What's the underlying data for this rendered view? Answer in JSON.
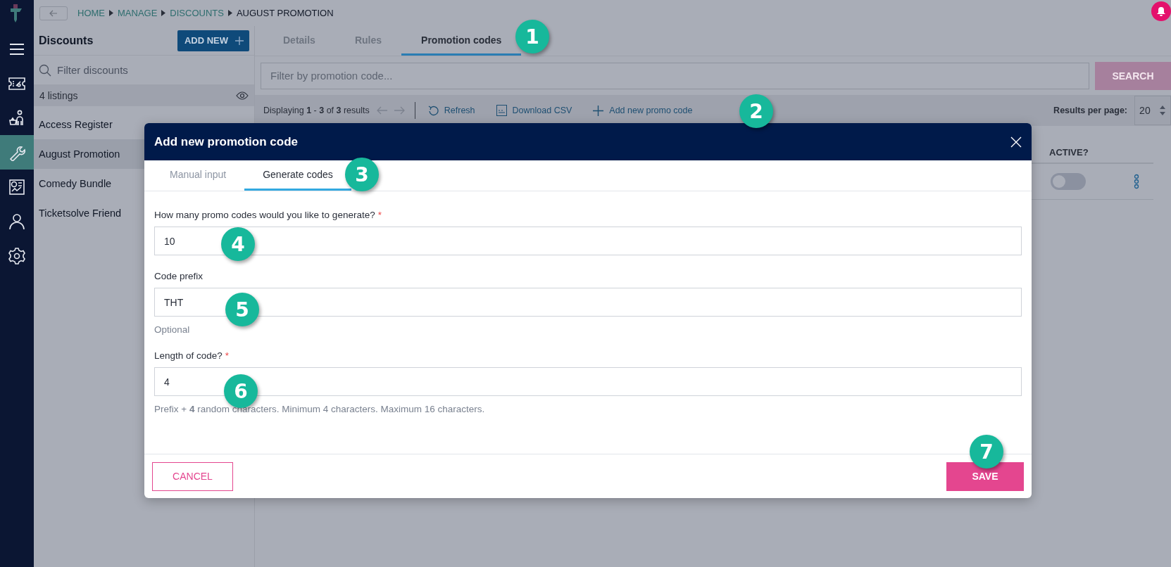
{
  "breadcrumb": [
    {
      "label": "HOME",
      "current": false
    },
    {
      "label": "MANAGE",
      "current": false
    },
    {
      "label": "DISCOUNTS",
      "current": false
    },
    {
      "label": "AUGUST PROMOTION",
      "current": true
    }
  ],
  "rail": {
    "items": [
      {
        "selected": false
      },
      {
        "selected": false
      },
      {
        "selected": false
      },
      {
        "selected": true
      },
      {
        "selected": false
      },
      {
        "selected": false
      },
      {
        "selected": false
      }
    ]
  },
  "list_panel": {
    "title": "Discounts",
    "add_button": "ADD NEW",
    "filter_placeholder": "Filter discounts",
    "count": "4 listings",
    "items": [
      {
        "label": "Access Register",
        "selected": false
      },
      {
        "label": "August Promotion",
        "selected": true
      },
      {
        "label": "Comedy Bundle",
        "selected": false
      },
      {
        "label": "Ticketsolve Friend",
        "selected": false
      }
    ]
  },
  "tabs": [
    {
      "label": "Details",
      "selected": false
    },
    {
      "label": "Rules",
      "selected": false
    },
    {
      "label": "Promotion codes",
      "selected": true
    }
  ],
  "promo_filter": {
    "placeholder": "Filter by promotion code...",
    "button": "SEARCH"
  },
  "toolbar": {
    "displaying": "Displaying **1** - **3** of **3** results",
    "refresh": "Refresh",
    "download": "Download CSV",
    "add": "Add new promo code",
    "results_label": "Results per page:",
    "per_page": "20"
  },
  "table": {
    "columns": [
      "ACTIVE?"
    ],
    "rows": [
      {
        "active": false
      }
    ]
  },
  "dialog": {
    "title": "Add new promotion code",
    "tabs": [
      {
        "label": "Manual input",
        "selected": false
      },
      {
        "label": "Generate codes",
        "selected": true
      }
    ],
    "fields": [
      {
        "label": "How many promo codes would you like to generate?",
        "required_mark": "*",
        "value": "10"
      },
      {
        "label": "Code prefix",
        "value": "THT",
        "help": "Optional"
      },
      {
        "label": "Length of code?",
        "required_mark": "*",
        "value": "4",
        "help": "Prefix + **4** random characters. Minimum 4 characters. Maximum 16 characters."
      }
    ],
    "cancel": "CANCEL",
    "save": "SAVE"
  },
  "markers": [
    "1",
    "2",
    "3",
    "4",
    "5",
    "6",
    "7"
  ]
}
